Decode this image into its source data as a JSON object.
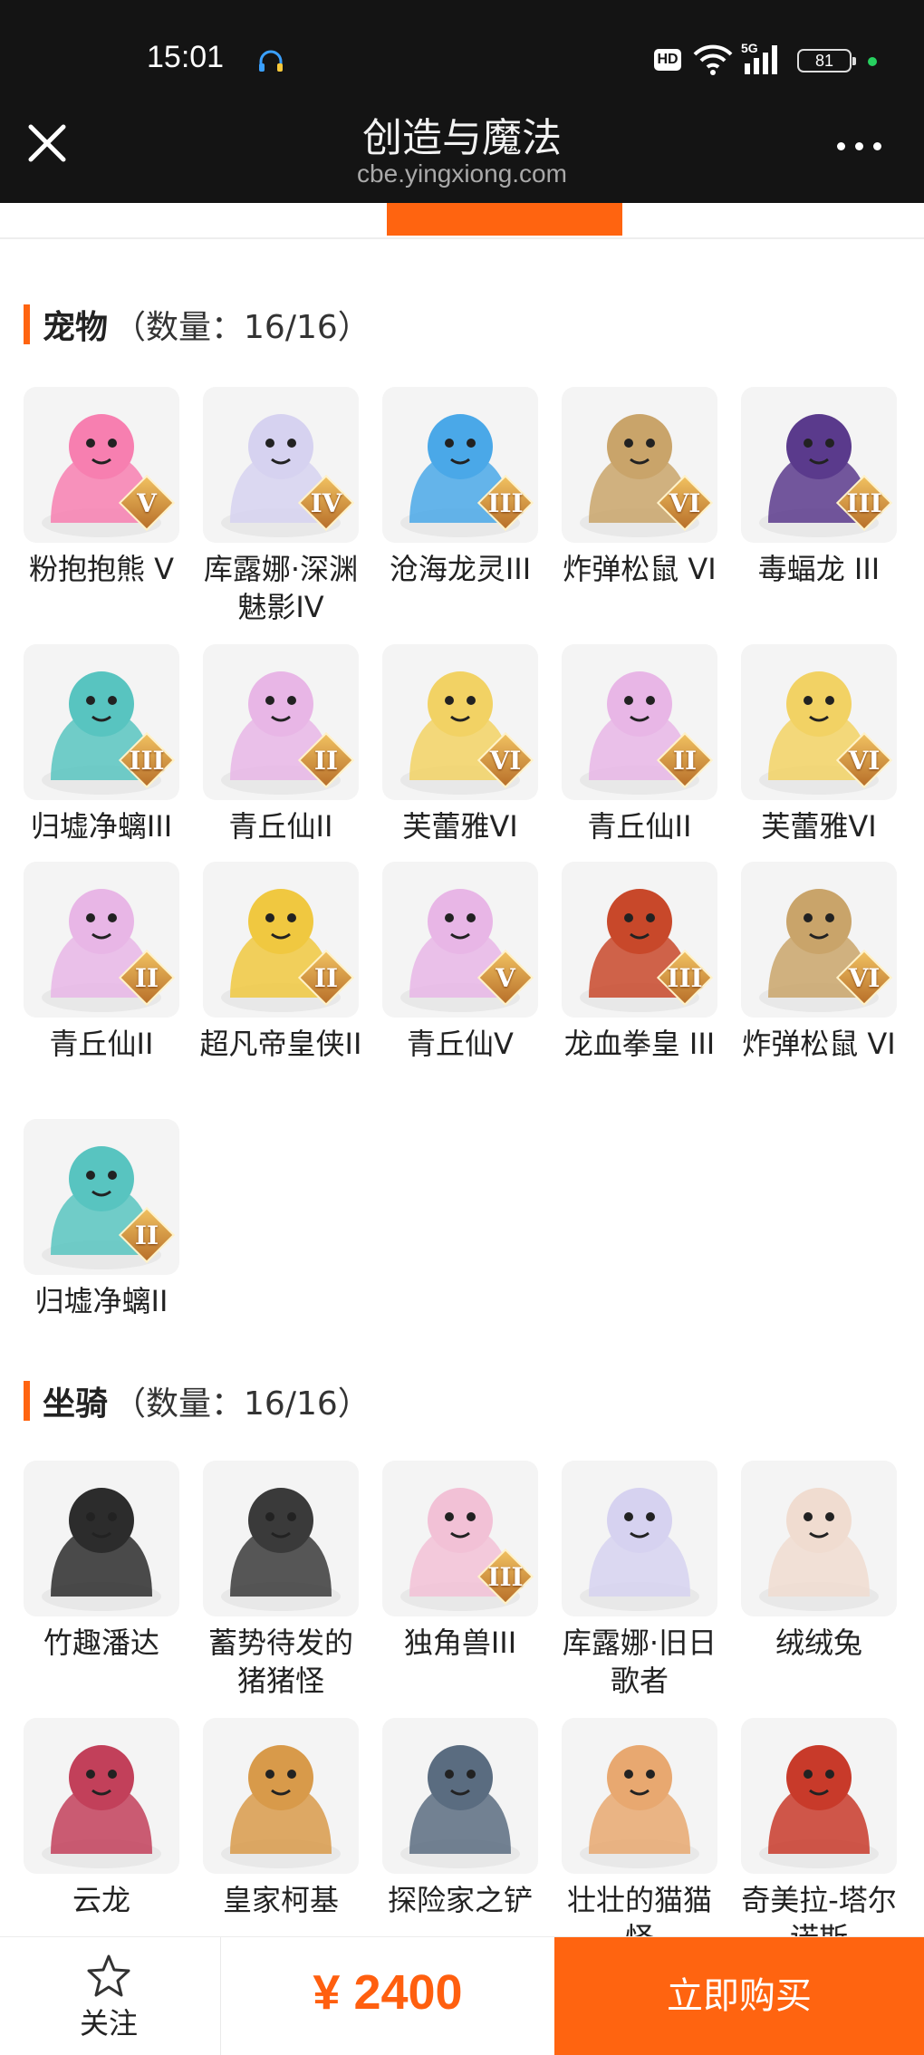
{
  "status_bar": {
    "time": "15:01",
    "network_badge": "HD",
    "cellular": "5G",
    "battery": "81",
    "icons": [
      "headset-icon",
      "wifi-icon",
      "signal-icon",
      "battery-icon"
    ]
  },
  "header": {
    "title": "创造与魔法",
    "url": "cbe.yingxiong.com",
    "close_icon": "close-icon",
    "more_icon": "more-icon"
  },
  "accent_color": "#ff6410",
  "pets": {
    "title": "宠物",
    "count": "（数量：16/16）",
    "items": [
      {
        "name": "粉抱抱熊 V",
        "tier": "V"
      },
      {
        "name": "库露娜·深渊魅影IV",
        "tier": "IV"
      },
      {
        "name": "沧海龙灵III",
        "tier": "III"
      },
      {
        "name": "炸弹松鼠 VI",
        "tier": "VI"
      },
      {
        "name": "毒蝠龙 III",
        "tier": "III"
      },
      {
        "name": "归墟净螭III",
        "tier": "III"
      },
      {
        "name": "青丘仙II",
        "tier": "II"
      },
      {
        "name": "芙蕾雅VI",
        "tier": "VI"
      },
      {
        "name": "青丘仙II",
        "tier": "II"
      },
      {
        "name": "芙蕾雅VI",
        "tier": "VI"
      },
      {
        "name": "青丘仙II",
        "tier": "II"
      },
      {
        "name": "超凡帝皇侠II",
        "tier": "II"
      },
      {
        "name": "青丘仙V",
        "tier": "V"
      },
      {
        "name": "龙血拳皇 III",
        "tier": "III"
      },
      {
        "name": "炸弹松鼠 VI",
        "tier": "VI"
      },
      {
        "name": "归墟净螭II",
        "tier": "II"
      }
    ]
  },
  "mounts": {
    "title": "坐骑",
    "count": "（数量：16/16）",
    "items": [
      {
        "name": "竹趣潘达",
        "tier": ""
      },
      {
        "name": "蓄势待发的猪猪怪",
        "tier": ""
      },
      {
        "name": "独角兽III",
        "tier": "III"
      },
      {
        "name": "库露娜·旧日歌者",
        "tier": ""
      },
      {
        "name": "绒绒兔",
        "tier": ""
      },
      {
        "name": "云龙",
        "tier": ""
      },
      {
        "name": "皇家柯基",
        "tier": ""
      },
      {
        "name": "探险家之铲",
        "tier": ""
      },
      {
        "name": "壮壮的猫猫怪",
        "tier": ""
      },
      {
        "name": "奇美拉-塔尔诺斯",
        "tier": ""
      }
    ]
  },
  "bottom_bar": {
    "follow_label": "关注",
    "price": "¥ 2400",
    "buy_label": "立即购买"
  }
}
